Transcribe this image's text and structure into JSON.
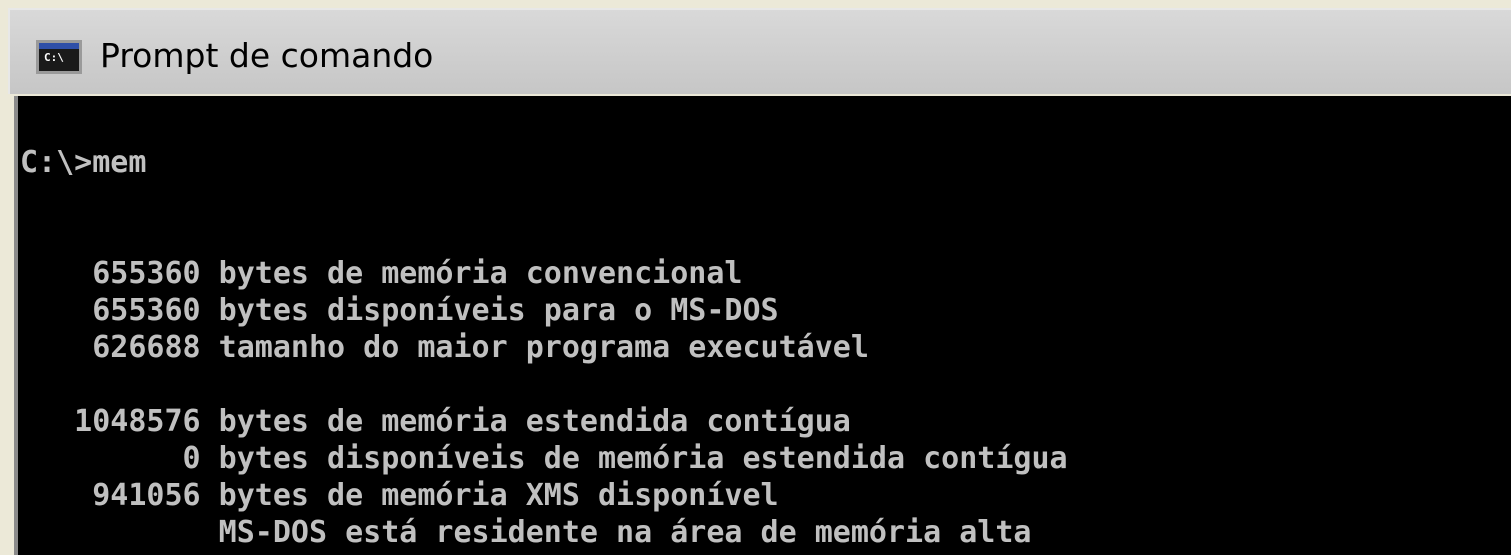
{
  "window": {
    "title": "Prompt de comando",
    "icon": "cmd-console-icon",
    "icon_label": "C:\\"
  },
  "console": {
    "lines": [
      "C:\\>mem",
      "",
      "",
      "    655360 bytes de memória convencional",
      "    655360 bytes disponíveis para o MS-DOS",
      "    626688 tamanho do maior programa executável",
      "",
      "   1048576 bytes de memória estendida contígua",
      "         0 bytes disponíveis de memória estendida contígua",
      "    941056 bytes de memória XMS disponível",
      "           MS-DOS está residente na área de memória alta"
    ]
  },
  "colors": {
    "titlebar": "#c6c6c6",
    "console_background": "#000000",
    "console_text": "#c0c0c0"
  }
}
